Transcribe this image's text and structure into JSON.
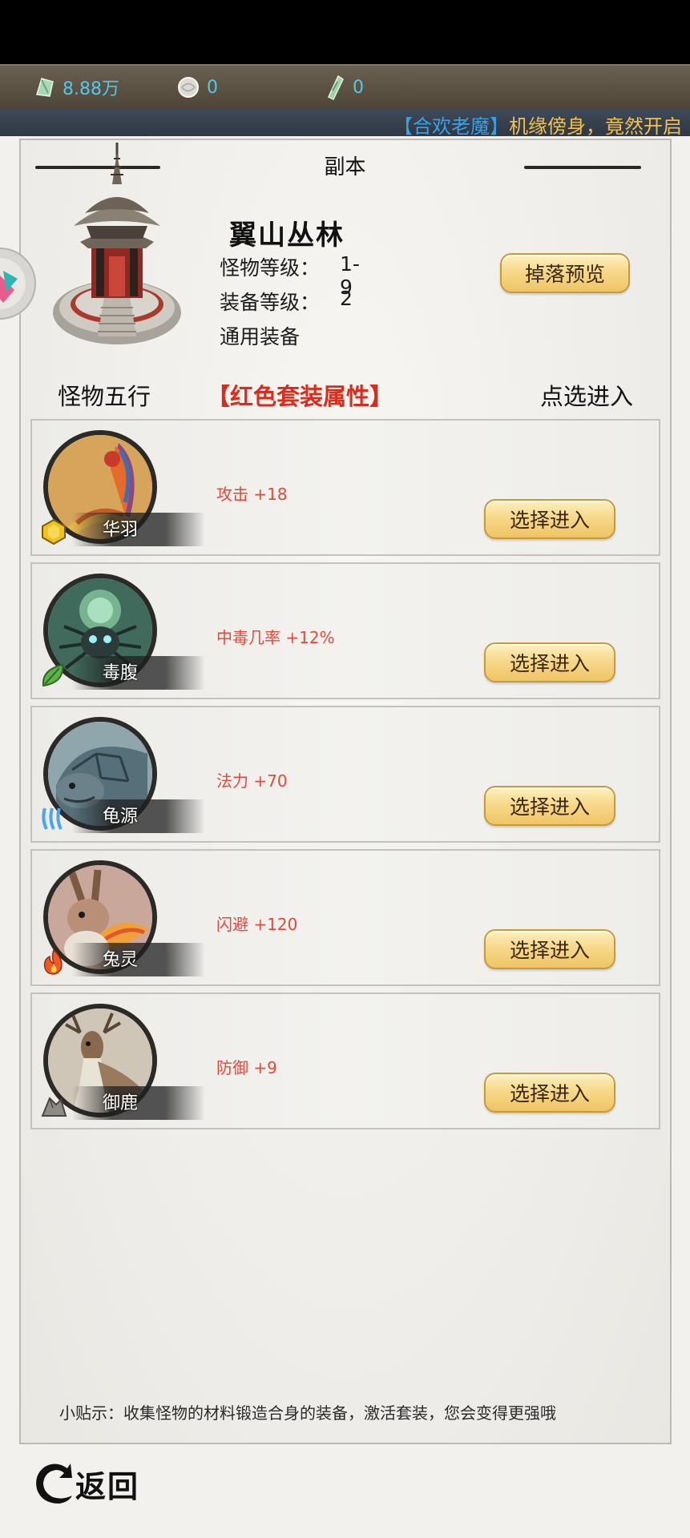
{
  "currency": {
    "jade": "8.88万",
    "pearl": "0",
    "ticket": "0"
  },
  "ticker": {
    "highlight": "【合欢老魔】",
    "text": "机缘傍身，竟然开启"
  },
  "panel": {
    "title": "副本"
  },
  "dungeon": {
    "name": "翼山丛林",
    "monster_level_label": "怪物等级：",
    "monster_level": "1-9",
    "equip_level_label": "装备等级：",
    "equip_level": "2",
    "equip_type": "通用装备",
    "drop_preview_label": "掉落预览"
  },
  "list_header": {
    "col1": "怪物五行",
    "col2": "【红色套装属性】",
    "col3": "点选进入"
  },
  "monsters": [
    {
      "name": "华羽",
      "attr": "攻击 +18",
      "element": "metal-element-icon",
      "button": "选择进入"
    },
    {
      "name": "毒腹",
      "attr": "中毒几率 +12%",
      "element": "wood-element-icon",
      "button": "选择进入"
    },
    {
      "name": "龟源",
      "attr": "法力 +70",
      "element": "water-element-icon",
      "button": "选择进入"
    },
    {
      "name": "兔灵",
      "attr": "闪避 +120",
      "element": "fire-element-icon",
      "button": "选择进入"
    },
    {
      "name": "御鹿",
      "attr": "防御 +9",
      "element": "earth-element-icon",
      "button": "选择进入"
    }
  ],
  "tip": "小贴示：收集怪物的材料锻造合身的装备，激活套装，您会变得更强哦",
  "back_label": "返回",
  "colors": {
    "accent_red": "#d82c1c",
    "currency_cyan": "#55c8e8",
    "button_gold": "#f7d98a"
  }
}
